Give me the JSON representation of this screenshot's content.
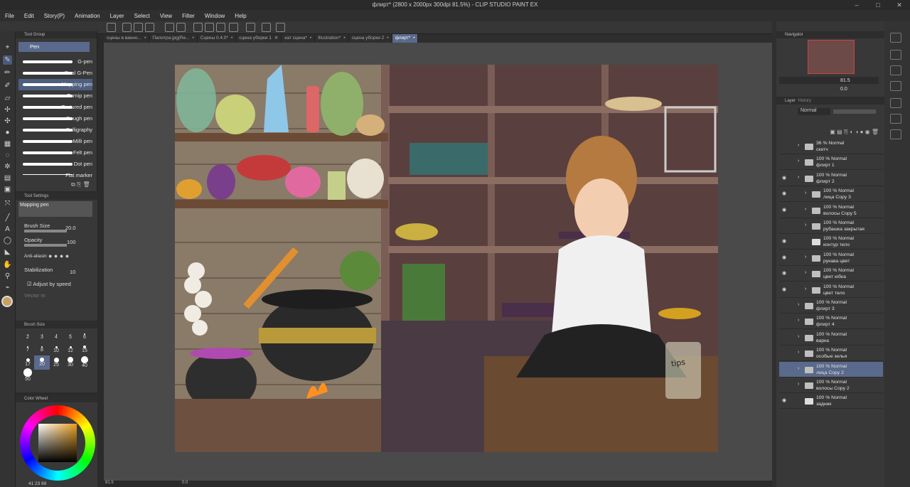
{
  "window": {
    "title": "флирт* (2800 x 2000px 300dpi 81.5%)  - CLIP STUDIO PAINT EX"
  },
  "menu": [
    "File",
    "Edit",
    "Story(P)",
    "Animation",
    "Layer",
    "Select",
    "View",
    "Filter",
    "Window",
    "Help"
  ],
  "tabs": [
    {
      "label": "сцены в ванно..."
    },
    {
      "label": "Палитра.jpg(Re..."
    },
    {
      "label": "Сцены 0.4.0*"
    },
    {
      "label": "сцена уборки 1"
    },
    {
      "label": "кат сцена*"
    },
    {
      "label": "Illustration*"
    },
    {
      "label": "сцена уборки 2"
    },
    {
      "label": "флирт*"
    }
  ],
  "tool_group": {
    "header": "Tool Group",
    "active": "Pen",
    "brushes": [
      "G-pen",
      "Real G-Pen",
      "Mapping pen",
      "Turnip pen",
      "Textured pen",
      "Rough pen",
      "Calligraphy",
      "Milli pen",
      "Felt pen",
      "Dot pen",
      "Flat marker"
    ],
    "selected": "Mapping pen"
  },
  "tool_settings": {
    "header": "Tool Settings",
    "preset": "Mapping pen",
    "brush_size_label": "Brush Size",
    "brush_size": "20.0",
    "opacity_label": "Opacity",
    "opacity": "100",
    "antialias_label": "Anti-aliasin",
    "stabilization_label": "Stabilization",
    "stabilization": "10",
    "adjust_label": "Adjust by speed",
    "vector_label": "Vector m"
  },
  "brush_size_panel": {
    "header": "Brush Size",
    "sizes": [
      "2",
      "3",
      "4",
      "5",
      "6",
      "7",
      "8",
      "10",
      "12",
      "15",
      "17",
      "20",
      "25",
      "30",
      "40",
      "50"
    ]
  },
  "color_panel": {
    "header": "Color Wheel",
    "readout": "41  23  69",
    "main_color": "#c9a060"
  },
  "navigator": {
    "header": "Navigator",
    "zoom": "81.5",
    "angle": "0.0"
  },
  "layer_panel": {
    "tab_layer": "Layer",
    "tab_history": "History",
    "blend_mode": "Normal",
    "layers": [
      {
        "mode": "36 % Normal",
        "name": "скетч",
        "folder": true,
        "indent": 0,
        "visible": false
      },
      {
        "mode": "100 % Normal",
        "name": "флирт 1",
        "folder": true,
        "indent": 0,
        "visible": false
      },
      {
        "mode": "100 % Normal",
        "name": "флирт 2",
        "folder": true,
        "indent": 0,
        "visible": true
      },
      {
        "mode": "100 % Normal",
        "name": "лица Copy 3",
        "folder": true,
        "indent": 1,
        "visible": true
      },
      {
        "mode": "100 % Normal",
        "name": "волосы Copy 5",
        "folder": true,
        "indent": 1,
        "visible": true
      },
      {
        "mode": "100 % Normal",
        "name": "рубашка закрытая",
        "folder": true,
        "indent": 1,
        "visible": false
      },
      {
        "mode": "100 % Normal",
        "name": "контур тело",
        "folder": false,
        "indent": 1,
        "visible": true
      },
      {
        "mode": "100 % Normal",
        "name": "рукава цвет",
        "folder": true,
        "indent": 1,
        "visible": true
      },
      {
        "mode": "100 % Normal",
        "name": "цвет юбка",
        "folder": true,
        "indent": 1,
        "visible": true
      },
      {
        "mode": "100 % Normal",
        "name": "цвет тело",
        "folder": true,
        "indent": 1,
        "visible": true
      },
      {
        "mode": "100 % Normal",
        "name": "флирт 3",
        "folder": true,
        "indent": 0,
        "visible": false
      },
      {
        "mode": "100 % Normal",
        "name": "флирт 4",
        "folder": true,
        "indent": 0,
        "visible": false
      },
      {
        "mode": "100 % Normal",
        "name": "варка",
        "folder": true,
        "indent": 0,
        "visible": false
      },
      {
        "mode": "100 % Normal",
        "name": "особые зелья",
        "folder": true,
        "indent": 0,
        "visible": false
      },
      {
        "mode": "100 % Normal",
        "name": "лица Copy 2",
        "folder": true,
        "indent": 0,
        "visible": false,
        "selected": true
      },
      {
        "mode": "100 % Normal",
        "name": "волосы Copy 2",
        "folder": true,
        "indent": 0,
        "visible": false
      },
      {
        "mode": "100 % Normal",
        "name": "задник",
        "folder": false,
        "indent": 0,
        "visible": true
      }
    ]
  },
  "canvas": {
    "jar_label": "tips"
  },
  "status": {
    "zoom": "81.5",
    "angle": "0.0"
  }
}
